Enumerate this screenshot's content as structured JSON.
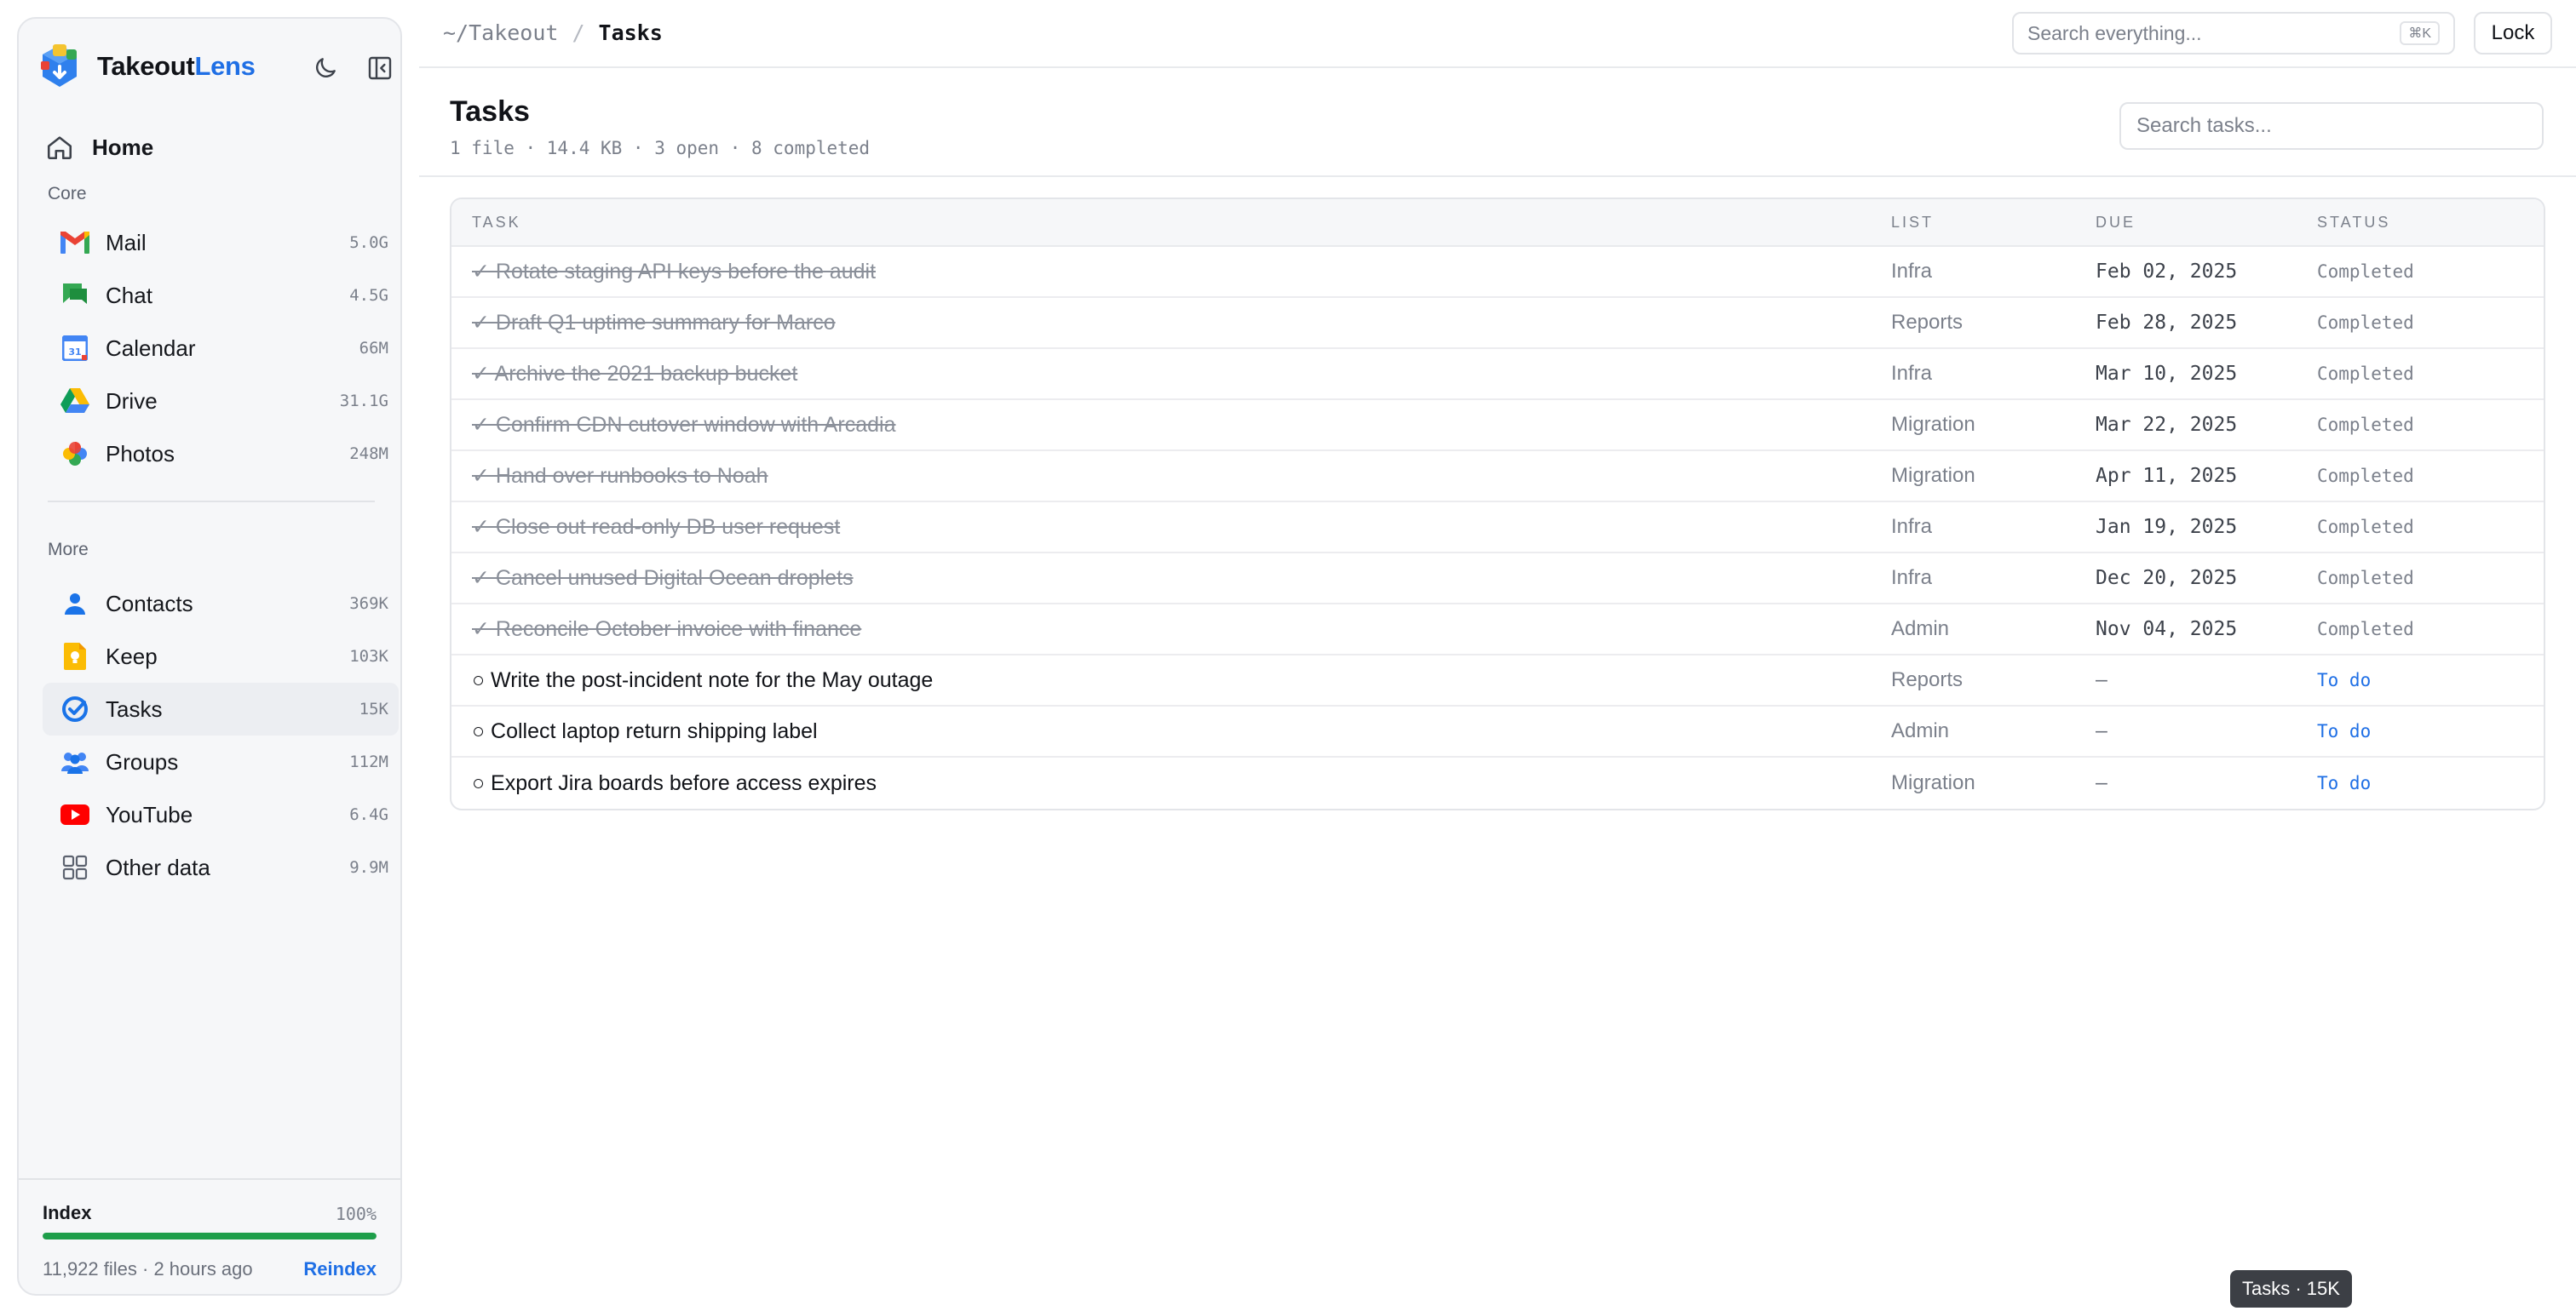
{
  "brand": {
    "name_part1": "Takeout",
    "name_part2": "Lens"
  },
  "sidebar": {
    "home_label": "Home",
    "core_heading": "Core",
    "more_heading": "More",
    "core_items": [
      {
        "label": "Mail",
        "size": "5.0G",
        "icon": "gmail-icon"
      },
      {
        "label": "Chat",
        "size": "4.5G",
        "icon": "chat-icon"
      },
      {
        "label": "Calendar",
        "size": "66M",
        "icon": "calendar-icon"
      },
      {
        "label": "Drive",
        "size": "31.1G",
        "icon": "drive-icon"
      },
      {
        "label": "Photos",
        "size": "248M",
        "icon": "photos-icon"
      }
    ],
    "more_items": [
      {
        "label": "Contacts",
        "size": "369K",
        "icon": "contacts-icon"
      },
      {
        "label": "Keep",
        "size": "103K",
        "icon": "keep-icon"
      },
      {
        "label": "Tasks",
        "size": "15K",
        "icon": "tasks-icon",
        "active": true
      },
      {
        "label": "Groups",
        "size": "112M",
        "icon": "groups-icon"
      },
      {
        "label": "YouTube",
        "size": "6.4G",
        "icon": "youtube-icon"
      },
      {
        "label": "Other data",
        "size": "9.9M",
        "icon": "grid-icon"
      }
    ],
    "index": {
      "label": "Index",
      "percent_text": "100%",
      "progress": 1.0,
      "meta": "11,922 files · 2 hours ago",
      "reindex_label": "Reindex"
    }
  },
  "topbar": {
    "breadcrumb_root": "~/Takeout",
    "breadcrumb_sep": "/",
    "breadcrumb_current": "Tasks",
    "search_placeholder": "Search everything...",
    "search_shortcut": "⌘K",
    "lock_label": "Lock"
  },
  "page": {
    "title": "Tasks",
    "meta": "1 file · 14.4 KB · 3 open · 8 completed",
    "search_placeholder": "Search tasks..."
  },
  "table": {
    "headers": {
      "task": "TASK",
      "list": "LIST",
      "due": "DUE",
      "status": "STATUS"
    },
    "rows": [
      {
        "state": "done",
        "task": "✓ Rotate staging API keys before the audit",
        "list": "Infra",
        "due": "Feb 02, 2025",
        "status": "Completed"
      },
      {
        "state": "done",
        "task": "✓ Draft Q1 uptime summary for Marco",
        "list": "Reports",
        "due": "Feb 28, 2025",
        "status": "Completed"
      },
      {
        "state": "done",
        "task": "✓ Archive the 2021 backup bucket",
        "list": "Infra",
        "due": "Mar 10, 2025",
        "status": "Completed"
      },
      {
        "state": "done",
        "task": "✓ Confirm CDN cutover window with Arcadia",
        "list": "Migration",
        "due": "Mar 22, 2025",
        "status": "Completed"
      },
      {
        "state": "done",
        "task": "✓ Hand over runbooks to Noah",
        "list": "Migration",
        "due": "Apr 11, 2025",
        "status": "Completed"
      },
      {
        "state": "done",
        "task": "✓ Close out read-only DB user request",
        "list": "Infra",
        "due": "Jan 19, 2025",
        "status": "Completed"
      },
      {
        "state": "done",
        "task": "✓ Cancel unused Digital Ocean droplets",
        "list": "Infra",
        "due": "Dec 20, 2025",
        "status": "Completed"
      },
      {
        "state": "done",
        "task": "✓ Reconcile October invoice with finance",
        "list": "Admin",
        "due": "Nov 04, 2025",
        "status": "Completed"
      },
      {
        "state": "open",
        "task": "○ Write the post-incident note for the May outage",
        "list": "Reports",
        "due": "—",
        "status": "To do"
      },
      {
        "state": "open",
        "task": "○ Collect laptop return shipping label",
        "list": "Admin",
        "due": "—",
        "status": "To do"
      },
      {
        "state": "open",
        "task": "○ Export Jira boards before access expires",
        "list": "Migration",
        "due": "—",
        "status": "To do"
      }
    ]
  },
  "toast": {
    "text": "Tasks · 15K"
  },
  "colors": {
    "accent": "#1f6fe5",
    "progress": "#1e9e4a",
    "toast_bg": "#3c3f45"
  }
}
